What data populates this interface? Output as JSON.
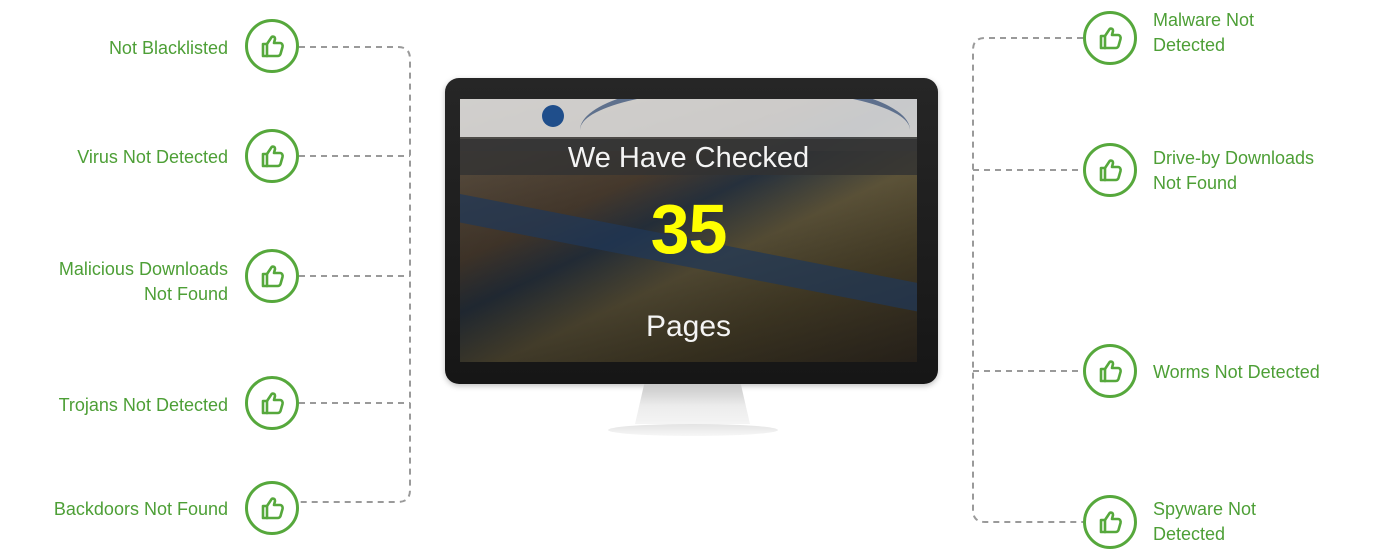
{
  "screen": {
    "headline": "We Have Checked",
    "count": "35",
    "unit": "Pages"
  },
  "left": [
    {
      "label": "Not Blacklisted",
      "icon": "thumbs-up-icon"
    },
    {
      "label": "Virus Not Detected",
      "icon": "thumbs-up-icon"
    },
    {
      "label": "Malicious Downloads",
      "label_line2": "Not Found",
      "icon": "thumbs-up-icon"
    },
    {
      "label": "Trojans Not Detected",
      "icon": "thumbs-up-icon"
    },
    {
      "label": "Backdoors Not Found",
      "icon": "thumbs-up-icon"
    }
  ],
  "right": [
    {
      "label": "Malware Not",
      "label_line2": "Detected",
      "icon": "thumbs-up-icon"
    },
    {
      "label": "Drive-by Downloads",
      "label_line2": "Not Found",
      "icon": "thumbs-up-icon"
    },
    {
      "label": "Worms Not Detected",
      "icon": "thumbs-up-icon"
    },
    {
      "label": "Spyware Not",
      "label_line2": "Detected",
      "icon": "thumbs-up-icon"
    }
  ],
  "colors": {
    "accent_green": "#4d9f36",
    "connector": "#9a9a9a",
    "highlight_yellow": "#ffff00"
  }
}
